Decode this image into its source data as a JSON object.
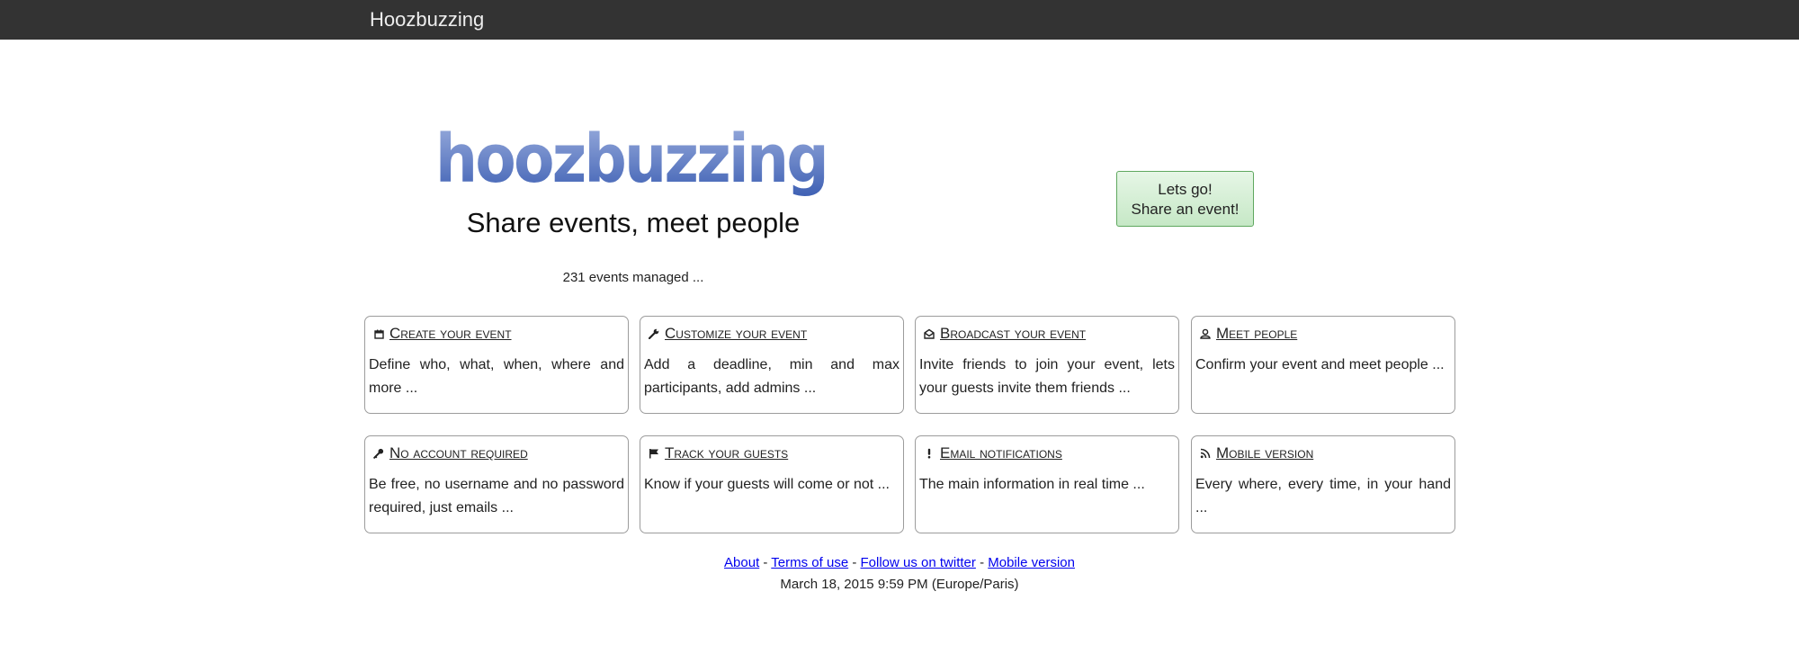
{
  "header": {
    "brand": "Hoozbuzzing"
  },
  "hero": {
    "logo_text": "hoozbuzzing",
    "tagline": "Share events, meet people",
    "counter": "231 events managed ...",
    "cta_line1": "Lets go!",
    "cta_line2": "Share an event!"
  },
  "colors": {
    "topbar": "#333333",
    "logo_gradient_top": "#8ea3d6",
    "logo_gradient_bottom": "#3d5fb3",
    "cta_background": "#c6e8c6",
    "link": "#0000ee"
  },
  "features": [
    {
      "icon": "calendar-icon",
      "title": "Create your event",
      "desc": "Define who, what, when, where and more ..."
    },
    {
      "icon": "wrench-icon",
      "title": "Customize your event",
      "desc": "Add a deadline, min and max participants, add admins ..."
    },
    {
      "icon": "envelope-icon",
      "title": "Broadcast your event",
      "desc": "Invite friends to join your event, lets your guests invite them friends ..."
    },
    {
      "icon": "user-icon",
      "title": "Meet people",
      "desc": "Confirm your event and meet people ..."
    },
    {
      "icon": "key-icon",
      "title": "No account required",
      "desc": "Be free, no username and no password required, just emails ..."
    },
    {
      "icon": "flag-icon",
      "title": "Track your guests",
      "desc": "Know if your guests will come or not ..."
    },
    {
      "icon": "exclamation-icon",
      "title": "Email notifications",
      "desc": "The main information in real time ..."
    },
    {
      "icon": "rss-icon",
      "title": "Mobile version",
      "desc": "Every where, every time, in your hand ..."
    }
  ],
  "footer": {
    "links": [
      "About",
      "Terms of use",
      "Follow us on twitter",
      "Mobile version"
    ],
    "separator": " - ",
    "datetime": "March 18, 2015 9:59 PM (Europe/Paris)"
  }
}
